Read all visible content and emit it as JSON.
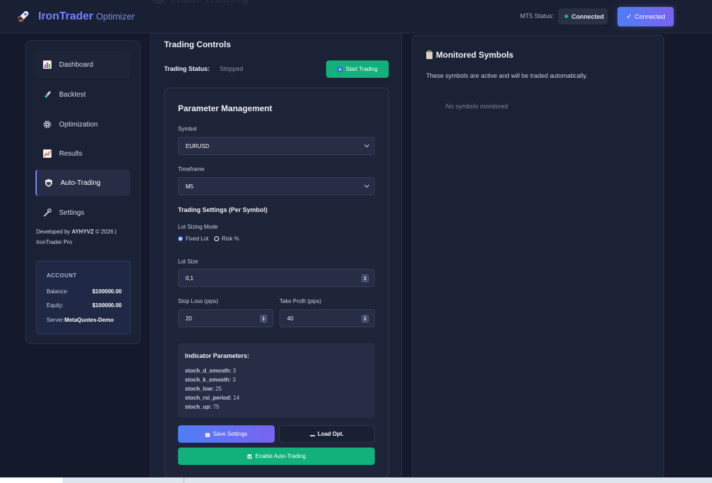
{
  "header": {
    "brand_main": "IronTrader",
    "brand_sub": "Optimizer",
    "ghost_title": "Auto-Trading",
    "mt5_label": "MT5 Status:",
    "mt5_status": "Connected",
    "connect_button": "Connected",
    "icons": {
      "logo": "rocket-icon",
      "status": "status-dot-icon",
      "connect": "checkmark-icon"
    }
  },
  "sidebar": {
    "items": [
      {
        "label": "Dashboard",
        "icon": "bar-chart-icon"
      },
      {
        "label": "Backtest",
        "icon": "test-tube-icon"
      },
      {
        "label": "Optimization",
        "icon": "gear-icon"
      },
      {
        "label": "Results",
        "icon": "line-chart-icon"
      },
      {
        "label": "Auto-Trading",
        "icon": "shield-icon"
      },
      {
        "label": "Settings",
        "icon": "wrench-icon"
      }
    ],
    "active_item": "Auto-Trading",
    "dev_prefix": "Developed by ",
    "dev_name": "AYHYVZ",
    "dev_suffix": " © 2026 |",
    "dev_line2": "IronTrader Pro",
    "account": {
      "title": "ACCOUNT",
      "balance_label": "Balance:",
      "balance_value": "$100000.00",
      "equity_label": "Equity:",
      "equity_value": "$100000.00",
      "server_label": "Server:",
      "server_value": "MetaQuotes-Demo"
    }
  },
  "controls": {
    "title": "Trading Controls",
    "status_label": "Trading Status:",
    "status_value": "Stopped",
    "start_button": "Start Trading",
    "params": {
      "title": "Parameter Management",
      "symbol_label": "Symbol",
      "symbol_value": "EURUSD",
      "timeframe_label": "Timeframe",
      "timeframe_value": "M5",
      "settings_title": "Trading Settings (Per Symbol)",
      "lot_mode_label": "Lot Sizing Mode",
      "lot_mode_options": [
        "Fixed Lot",
        "Risk %"
      ],
      "lot_mode_selected": "Fixed Lot",
      "lot_size_label": "Lot Size",
      "lot_size_value": "0,1",
      "stop_loss_label": "Stop Loss (pips)",
      "stop_loss_value": "20",
      "take_profit_label": "Take Profit (pips)",
      "take_profit_value": "40",
      "indicator_title": "Indicator Parameters:",
      "indicators": [
        {
          "key": "stoch_d_smooth:",
          "value": "3"
        },
        {
          "key": "stoch_k_smooth:",
          "value": "3"
        },
        {
          "key": "stoch_low:",
          "value": "25"
        },
        {
          "key": "stoch_rsi_period:",
          "value": "14"
        },
        {
          "key": "stoch_up:",
          "value": "75"
        }
      ],
      "save_button": "Save Settings",
      "load_button": "Load Opt.",
      "enable_button": "Enable Auto-Trading"
    }
  },
  "monitored": {
    "title": "Monitored Symbols",
    "description": "These symbols are active and will be traded automatically.",
    "empty_text": "No symbols monitored"
  },
  "colors": {
    "accent": "#6f84ff",
    "success": "#12b07a",
    "background": "#14192b",
    "panel": "#1c2235"
  }
}
